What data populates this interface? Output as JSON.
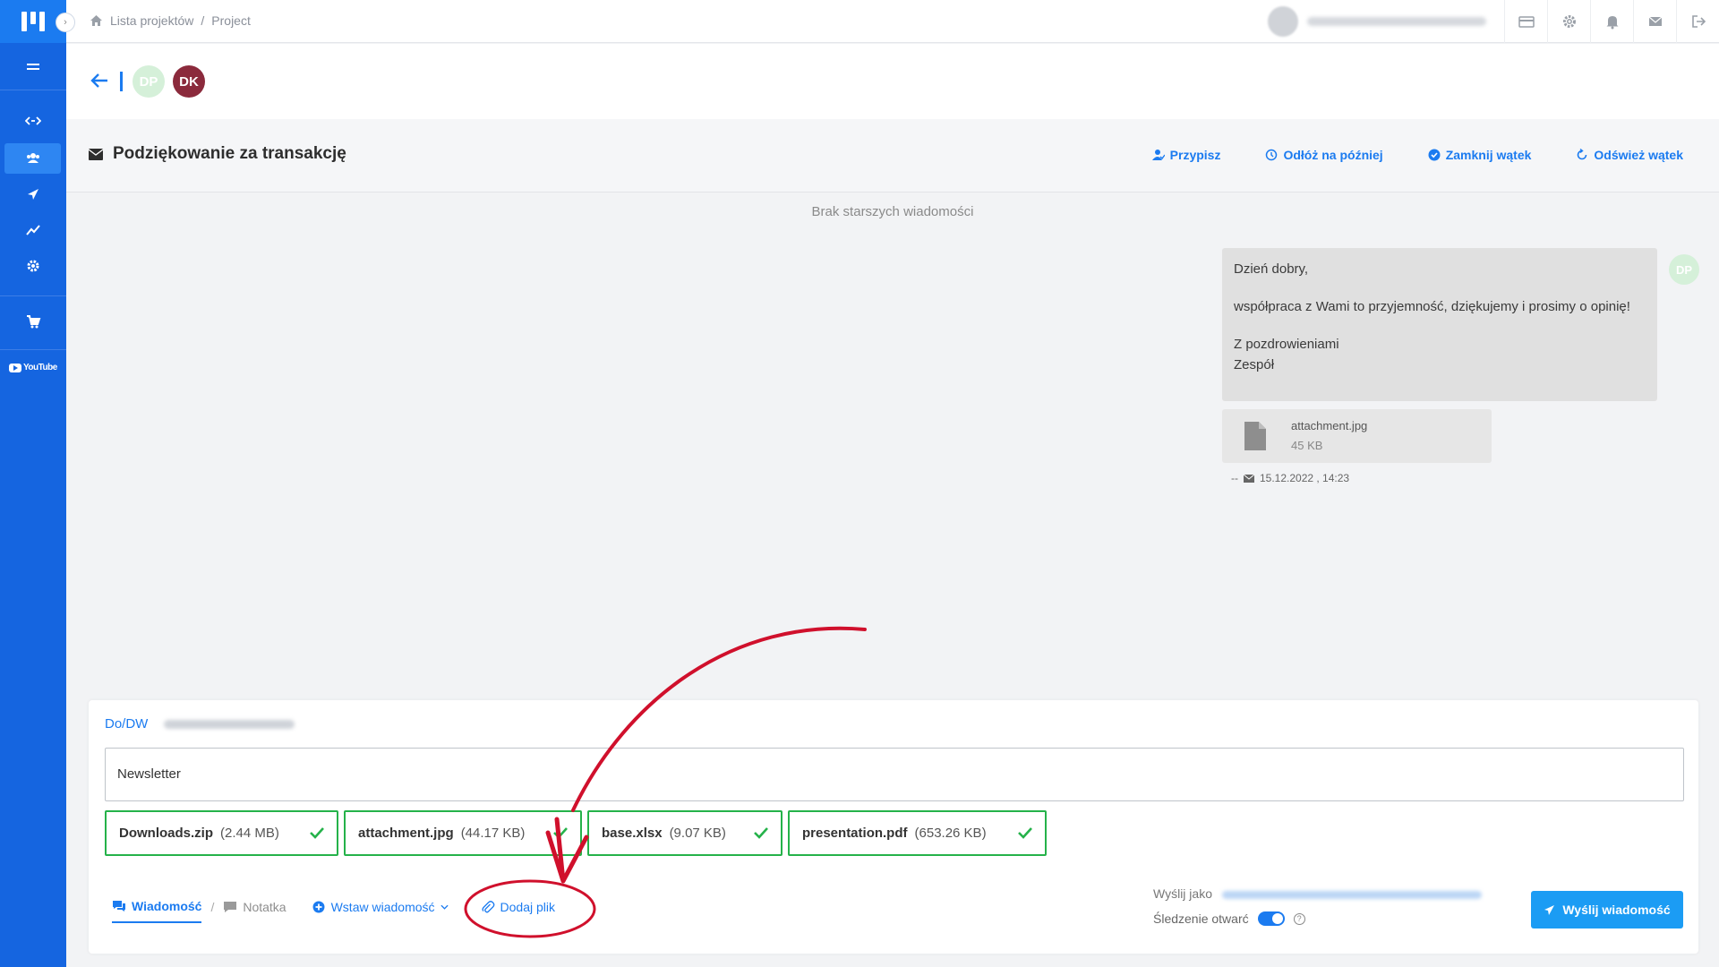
{
  "breadcrumb": {
    "home": "Lista projektów",
    "sep": "/",
    "current": "Project"
  },
  "thread": {
    "avatars": [
      {
        "initials": "DP",
        "color": "#d5f0d9"
      },
      {
        "initials": "DK",
        "color": "#8b2a3c"
      }
    ]
  },
  "subject": {
    "title": "Podziękowanie za transakcję",
    "actions": {
      "assign": "Przypisz",
      "postpone": "Odłóż na później",
      "close": "Zamknij wątek",
      "refresh": "Odśwież wątek"
    }
  },
  "conversation": {
    "no_older": "Brak starszych wiadomości",
    "message": {
      "greeting": "Dzień dobry,",
      "body": "współpraca z Wami to przyjemność, dziękujemy i prosimy o opinię!",
      "closing": "Z pozdrowieniami",
      "signature": "Zespół",
      "avatar": "DP"
    },
    "attachment": {
      "name": "attachment.jpg",
      "size": "45 KB"
    },
    "meta": {
      "dash": "--",
      "datetime": "15.12.2022 , 14:23"
    }
  },
  "composer": {
    "to_label": "Do/DW",
    "subject_value": "Newsletter",
    "files": [
      {
        "name": "Downloads.zip",
        "size": "(2.44 MB)"
      },
      {
        "name": "attachment.jpg",
        "size": "(44.17 KB)"
      },
      {
        "name": "base.xlsx",
        "size": "(9.07 KB)"
      },
      {
        "name": "presentation.pdf",
        "size": "(653.26 KB)"
      }
    ],
    "tabs": {
      "message": "Wiadomość",
      "sep": "/",
      "note": "Notatka"
    },
    "insert_message": "Wstaw wiadomość",
    "add_file": "Dodaj plik",
    "send_as_label": "Wyślij jako",
    "tracking_label": "Śledzenie otwarć",
    "tracking_on": true,
    "send_button": "Wyślij wiadomość"
  },
  "sidebar": {
    "youtube_label": "YouTube"
  },
  "colors": {
    "primary": "#1b7bf0",
    "sidebar": "#1565e0",
    "success": "#25b24a",
    "annotation": "#d0102c"
  }
}
